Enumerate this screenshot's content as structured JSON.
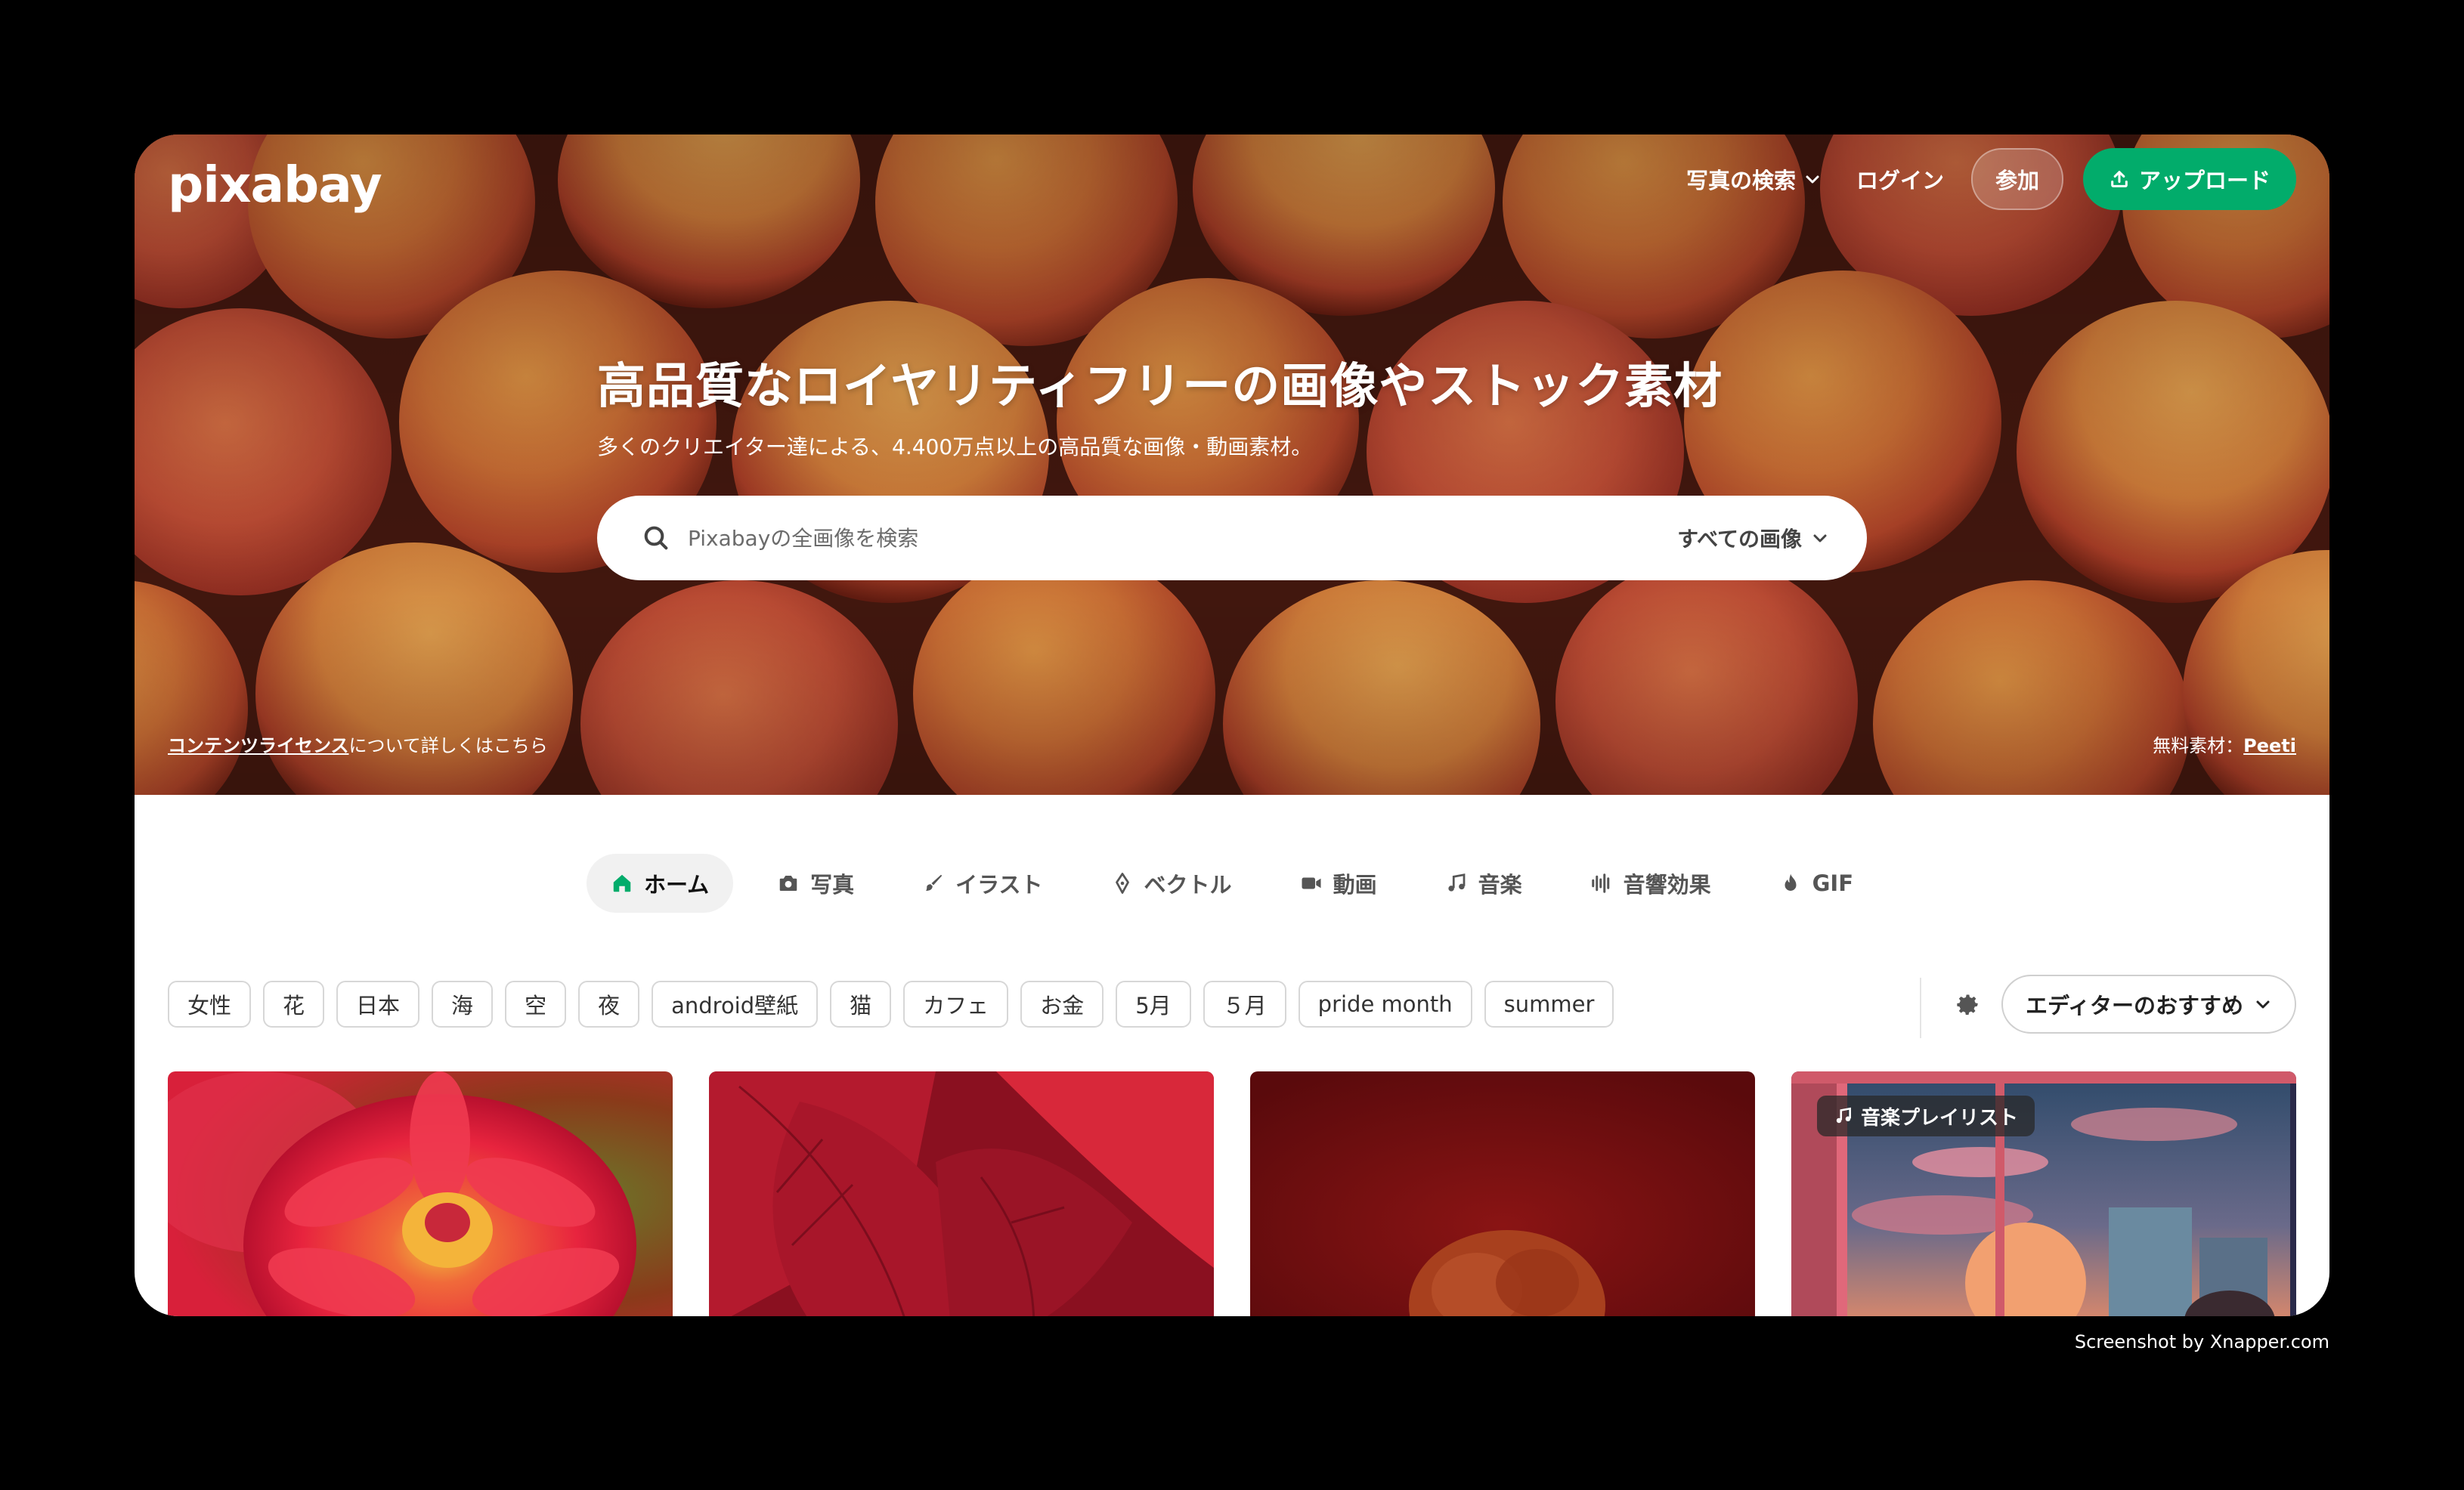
{
  "brand": {
    "logo_text": "pixabay",
    "accent": "#02ac6b"
  },
  "nav": {
    "explore_label": "写真の検索",
    "login_label": "ログイン",
    "join_label": "参加",
    "upload_label": "アップロード"
  },
  "hero": {
    "title": "高品質なロイヤリティフリーの画像やストック素材",
    "subtitle": "多くのクリエイター達による、4.400万点以上の高品質な画像・動画素材。",
    "search_placeholder": "Pixabayの全画像を検索",
    "search_filter_label": "すべての画像",
    "license_link": "コンテンツライセンス",
    "license_text": "について詳しくはこちら",
    "credit_prefix": "無料素材：",
    "credit_author": "Peeti"
  },
  "tabs": [
    {
      "label": "ホーム",
      "icon": "home-icon",
      "active": true
    },
    {
      "label": "写真",
      "icon": "camera-icon"
    },
    {
      "label": "イラスト",
      "icon": "brush-icon"
    },
    {
      "label": "ベクトル",
      "icon": "pen-nib-icon"
    },
    {
      "label": "動画",
      "icon": "video-icon"
    },
    {
      "label": "音楽",
      "icon": "music-note-icon"
    },
    {
      "label": "音響効果",
      "icon": "waveform-icon"
    },
    {
      "label": "GIF",
      "icon": "flame-icon"
    }
  ],
  "chips": [
    "女性",
    "花",
    "日本",
    "海",
    "空",
    "夜",
    "android壁紙",
    "猫",
    "カフェ",
    "お金",
    "5月",
    "５月",
    "pride month",
    "summer"
  ],
  "sort_label": "エディターのおすすめ",
  "gallery": {
    "badge_label": "音楽プレイリスト"
  },
  "footnote": "Screenshot by Xnapper.com"
}
